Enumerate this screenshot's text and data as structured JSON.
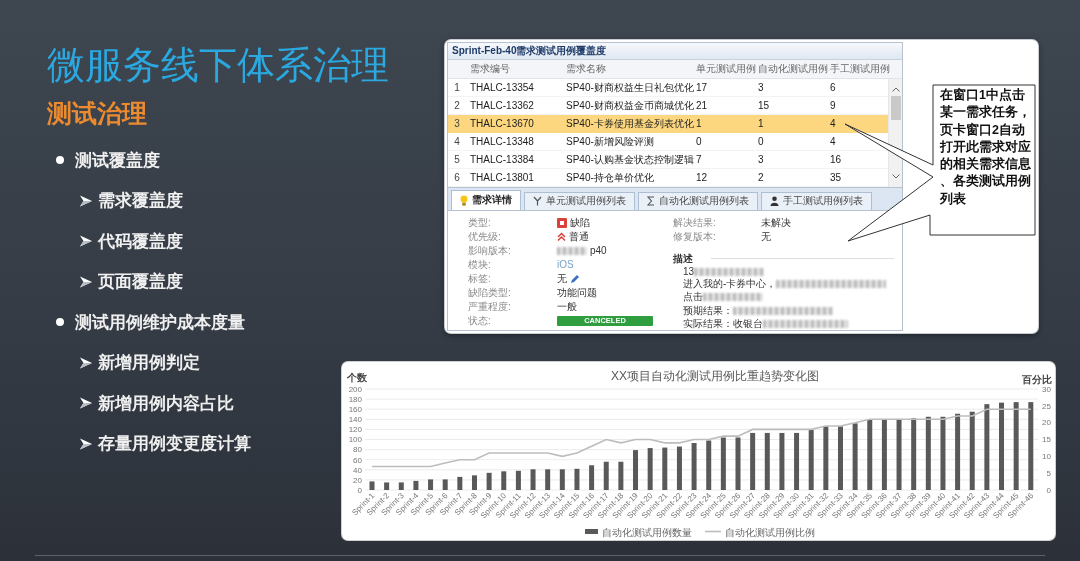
{
  "slide": {
    "title": "微服务线下体系治理",
    "subtitle": "测试治理",
    "bullets": [
      {
        "text": "测试覆盖度",
        "children": [
          {
            "text": "需求覆盖度"
          },
          {
            "text": "代码覆盖度"
          },
          {
            "text": "页面覆盖度"
          }
        ]
      },
      {
        "text": "测试用例维护成本度量",
        "children": [
          {
            "text": "新增用例判定"
          },
          {
            "text": "新增用例内容占比"
          },
          {
            "text": "存量用例变更度计算"
          }
        ]
      }
    ]
  },
  "window": {
    "title": "Sprint-Feb-40需求测试用例覆盖度",
    "table": {
      "columns": [
        "需求编号",
        "需求名称",
        "单元测试用例",
        "自动化测试用例",
        "手工测试用例"
      ],
      "rows": [
        {
          "index": "1",
          "cells": [
            "THALC-13354",
            "SP40-财商权益生日礼包优化",
            "17",
            "3",
            "6"
          ],
          "selected": false
        },
        {
          "index": "2",
          "cells": [
            "THALC-13362",
            "SP40-财商权益金币商城优化",
            "21",
            "15",
            "9"
          ],
          "selected": false
        },
        {
          "index": "3",
          "cells": [
            "THALC-13670",
            "SP40-卡券使用基金列表优化",
            "1",
            "1",
            "4"
          ],
          "selected": true
        },
        {
          "index": "4",
          "cells": [
            "THALC-13348",
            "SP40-新增风险评测",
            "0",
            "0",
            "4"
          ],
          "selected": false
        },
        {
          "index": "5",
          "cells": [
            "THALC-13384",
            "SP40-认购基金状态控制逻辑",
            "7",
            "3",
            "16"
          ],
          "selected": false
        },
        {
          "index": "6",
          "cells": [
            "THALC-13801",
            "SP40-持仓单价优化",
            "12",
            "2",
            "35"
          ],
          "selected": false
        }
      ]
    },
    "tabs": [
      {
        "label": "需求详情",
        "selected": true
      },
      {
        "label": "单元测试用例列表",
        "selected": false
      },
      {
        "label": "自动化测试用例列表",
        "selected": false
      },
      {
        "label": "手工测试用例列表",
        "selected": false
      }
    ],
    "details_left": [
      {
        "label": "类型:",
        "value": "缺陷",
        "kind": "text",
        "blurred_prefix": false
      },
      {
        "label": "优先级:",
        "value": "普通",
        "kind": "text",
        "blurred_prefix": false
      },
      {
        "label": "影响版本:",
        "value": "p40",
        "kind": "text",
        "blurred_prefix": true
      },
      {
        "label": "模块:",
        "value": "iOS",
        "kind": "link",
        "blurred_prefix": false
      },
      {
        "label": "标签:",
        "value": "无",
        "kind": "text",
        "blurred_prefix": false
      },
      {
        "label": "缺陷类型:",
        "value": "功能问题",
        "kind": "text",
        "blurred_prefix": false
      },
      {
        "label": "严重程度:",
        "value": "一般",
        "kind": "text",
        "blurred_prefix": false
      },
      {
        "label": "状态:",
        "value": "CANCELED",
        "kind": "badge",
        "blurred_prefix": false
      }
    ],
    "details_right": [
      {
        "label": "解决结果:",
        "value": "未解决"
      },
      {
        "label": "修复版本:",
        "value": "无"
      }
    ],
    "description": {
      "title": "描述",
      "paragraphs": [
        [
          {
            "text": "13",
            "blurred": true
          },
          {
            "text": "进入我的-卡券中心，",
            "blurred": true
          },
          {
            "text": "点击",
            "blurred": true
          }
        ],
        [
          {
            "text": "预期结果：",
            "blurred": true
          },
          {
            "text": "实际结果：收银台",
            "blurred": true
          }
        ]
      ]
    }
  },
  "callout": {
    "text": "在窗口1中点击某一需求任务，页卡窗口2自动打开此需求对应的相关需求信息、各类测试用例列表"
  },
  "chart": {
    "chart_data": {
      "type": "bar",
      "title": "XX项目自动化测试用例比重趋势变化图",
      "ylabel": "个数",
      "y2label": "百分比",
      "categories": [
        "Sprint-1",
        "Sprint-2",
        "Sprint-3",
        "Sprint-4",
        "Sprint-5",
        "Sprint-6",
        "Sprint-7",
        "Sprint-8",
        "Sprint-9",
        "Sprint-10",
        "Sprint-11",
        "Sprint-12",
        "Sprint-13",
        "Sprint-14",
        "Sprint-15",
        "Sprint-16",
        "Sprint-17",
        "Sprint-18",
        "Sprint-19",
        "Sprint-20",
        "Sprint-21",
        "Sprint-22",
        "Sprint-23",
        "Sprint-24",
        "Sprint-25",
        "Sprint-26",
        "Sprint-27",
        "Sprint-28",
        "Sprint-29",
        "Sprint-30",
        "Sprint-31",
        "Sprint-32",
        "Sprint-33",
        "Sprint-34",
        "Sprint-35",
        "Sprint-36",
        "Sprint-37",
        "Sprint-38",
        "Sprint-39",
        "Sprint-40",
        "Sprint-41",
        "Sprint-42",
        "Sprint-43",
        "Sprint-44",
        "Sprint-45",
        "Sprint-46"
      ],
      "ylim": [
        0,
        200
      ],
      "yticks": [
        0,
        20,
        40,
        60,
        80,
        100,
        120,
        140,
        160,
        180,
        200
      ],
      "y2lim": [
        0,
        30
      ],
      "y2ticks": [
        0,
        5,
        10,
        15,
        20,
        25,
        30
      ],
      "grid": true,
      "legend": "bottom",
      "series": [
        {
          "name": "自动化测试用例数量",
          "color": "#595959",
          "values": [
            17,
            15,
            15,
            18,
            21,
            21,
            26,
            29,
            34,
            37,
            38,
            41,
            41,
            41,
            42,
            49,
            56,
            56,
            79,
            83,
            84,
            86,
            93,
            98,
            104,
            104,
            113,
            113,
            113,
            113,
            119,
            126,
            126,
            132,
            139,
            139,
            139,
            142,
            145,
            145,
            151,
            155,
            170,
            173,
            174,
            174
          ]
        },
        {
          "name": "自动化测试用例比例",
          "type": "line",
          "axis": "y2",
          "color": "#bdbdbd",
          "values": [
            7,
            7,
            7,
            7,
            7,
            8,
            9,
            9,
            11,
            11,
            11,
            11,
            11,
            10,
            11,
            13,
            15,
            14,
            15,
            15,
            14,
            14,
            15,
            15,
            16,
            16,
            18,
            18,
            18,
            18,
            18,
            19,
            19,
            20,
            21,
            21,
            21,
            21,
            21,
            21,
            22,
            22,
            24,
            24,
            24,
            24
          ]
        }
      ]
    }
  }
}
